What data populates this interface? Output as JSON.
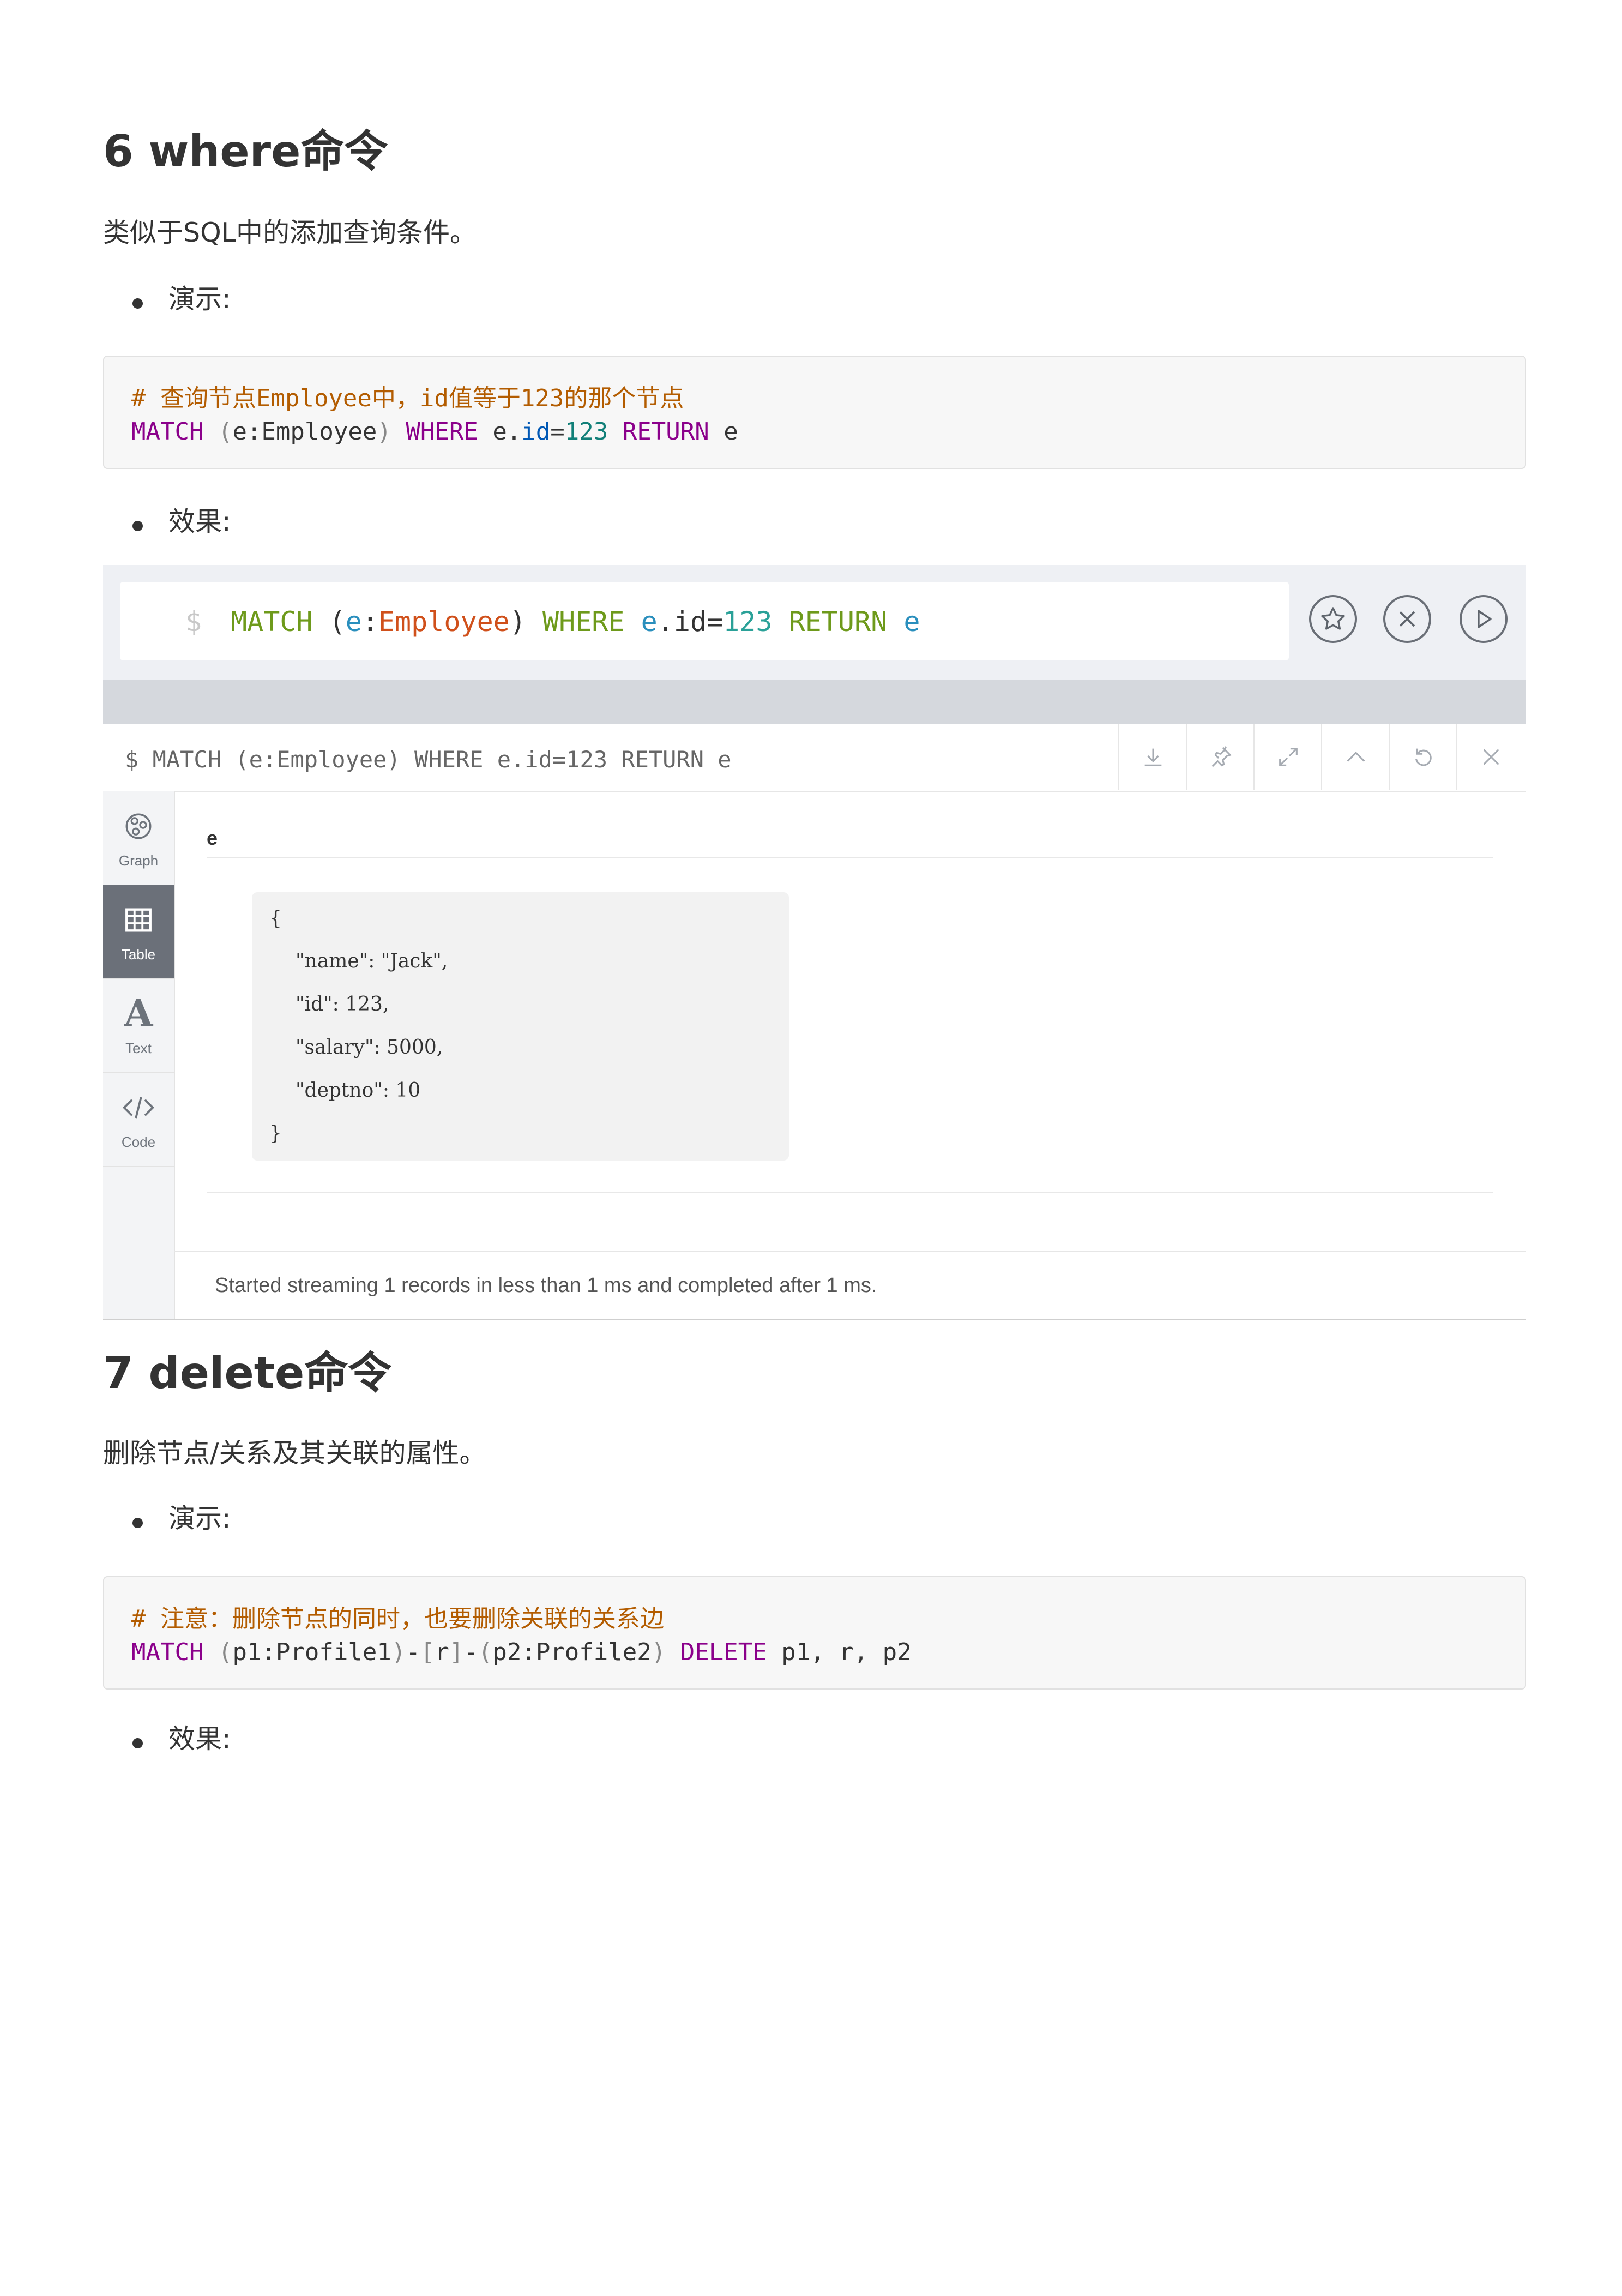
{
  "section6": {
    "heading": "6 where命令",
    "description": "类似于SQL中的添加查询条件。",
    "bullet_demo": "演示:",
    "code": {
      "comment": "# 查询节点Employee中，id值等于123的那个节点",
      "kw_match": "MATCH",
      "paren_open": "(",
      "node": "e:Employee",
      "paren_close": ")",
      "kw_where": "WHERE",
      "var_e": "e.",
      "prop_id": "id",
      "eq": "=",
      "num": "123",
      "kw_return": "RETURN",
      "ret": "e"
    },
    "bullet_result": "效果:"
  },
  "neo4j": {
    "editor": {
      "prompt": "$",
      "kw_match": "MATCH",
      "open": "(",
      "var": "e",
      "colon": ":",
      "label": "Employee",
      "close": ")",
      "kw_where": "WHERE",
      "var2": "e",
      "dot_id": ".id=",
      "num": "123",
      "kw_return": "RETURN",
      "var3": "e",
      "buttons": {
        "favorite_icon": "star-icon",
        "clear_icon": "close-circle-icon",
        "run_icon": "play-icon"
      }
    },
    "frame": {
      "query": "$ MATCH (e:Employee) WHERE e.id=123 RETURN e",
      "toolbar": [
        "download-icon",
        "pin-icon",
        "expand-icon",
        "collapse-icon",
        "rerun-icon",
        "close-icon"
      ]
    },
    "sidebar": [
      {
        "label": "Graph",
        "icon": "graph-icon",
        "active": false
      },
      {
        "label": "Table",
        "icon": "table-icon",
        "active": true
      },
      {
        "label": "Text",
        "icon": "text-icon",
        "active": false
      },
      {
        "label": "Code",
        "icon": "code-icon",
        "active": false
      }
    ],
    "table": {
      "column": "e",
      "json_lines": [
        "{",
        "\"name\": \"Jack\",",
        "\"id\": 123,",
        "\"salary\": 5000,",
        "\"deptno\": 10",
        "}"
      ]
    },
    "status": "Started streaming 1 records in less than 1 ms and completed after 1 ms."
  },
  "section7": {
    "heading": "7 delete命令",
    "description": "删除节点/关系及其关联的属性。",
    "bullet_demo": "演示:",
    "code": {
      "comment": "# 注意：删除节点的同时，也要删除关联的关系边",
      "kw_match": "MATCH",
      "p_open1": "(",
      "n1": "p1:Profile1",
      "p_close1": ")",
      "dash1": "-",
      "b_open": "[",
      "rel": "r",
      "b_close": "]",
      "dash2": "-",
      "p_open2": "(",
      "n2": "p2:Profile2",
      "p_close2": ")",
      "kw_delete": "DELETE",
      "targets": "p1, r, p2"
    },
    "bullet_result": "效果:"
  }
}
